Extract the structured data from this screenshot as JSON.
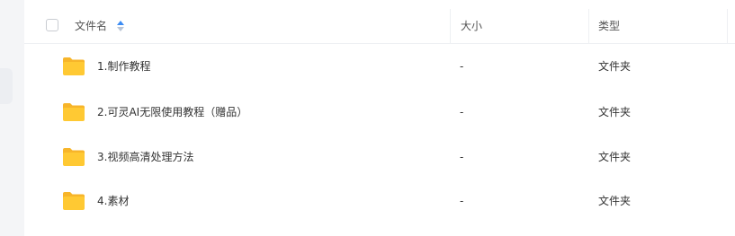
{
  "header": {
    "name_label": "文件名",
    "size_label": "大小",
    "type_label": "类型"
  },
  "colors": {
    "folder": "#ffc933",
    "folder_back": "#f7b52a",
    "sort_active": "#3c8cf4",
    "sort_inactive": "#b8c4d6"
  },
  "files": [
    {
      "name": "1.制作教程",
      "size": "-",
      "type": "文件夹",
      "icon": "folder-icon"
    },
    {
      "name": "2.可灵AI无限使用教程（赠品）",
      "size": "-",
      "type": "文件夹",
      "icon": "folder-icon"
    },
    {
      "name": "3.视频高清处理方法",
      "size": "-",
      "type": "文件夹",
      "icon": "folder-icon"
    },
    {
      "name": "4.素材",
      "size": "-",
      "type": "文件夹",
      "icon": "folder-icon"
    }
  ]
}
